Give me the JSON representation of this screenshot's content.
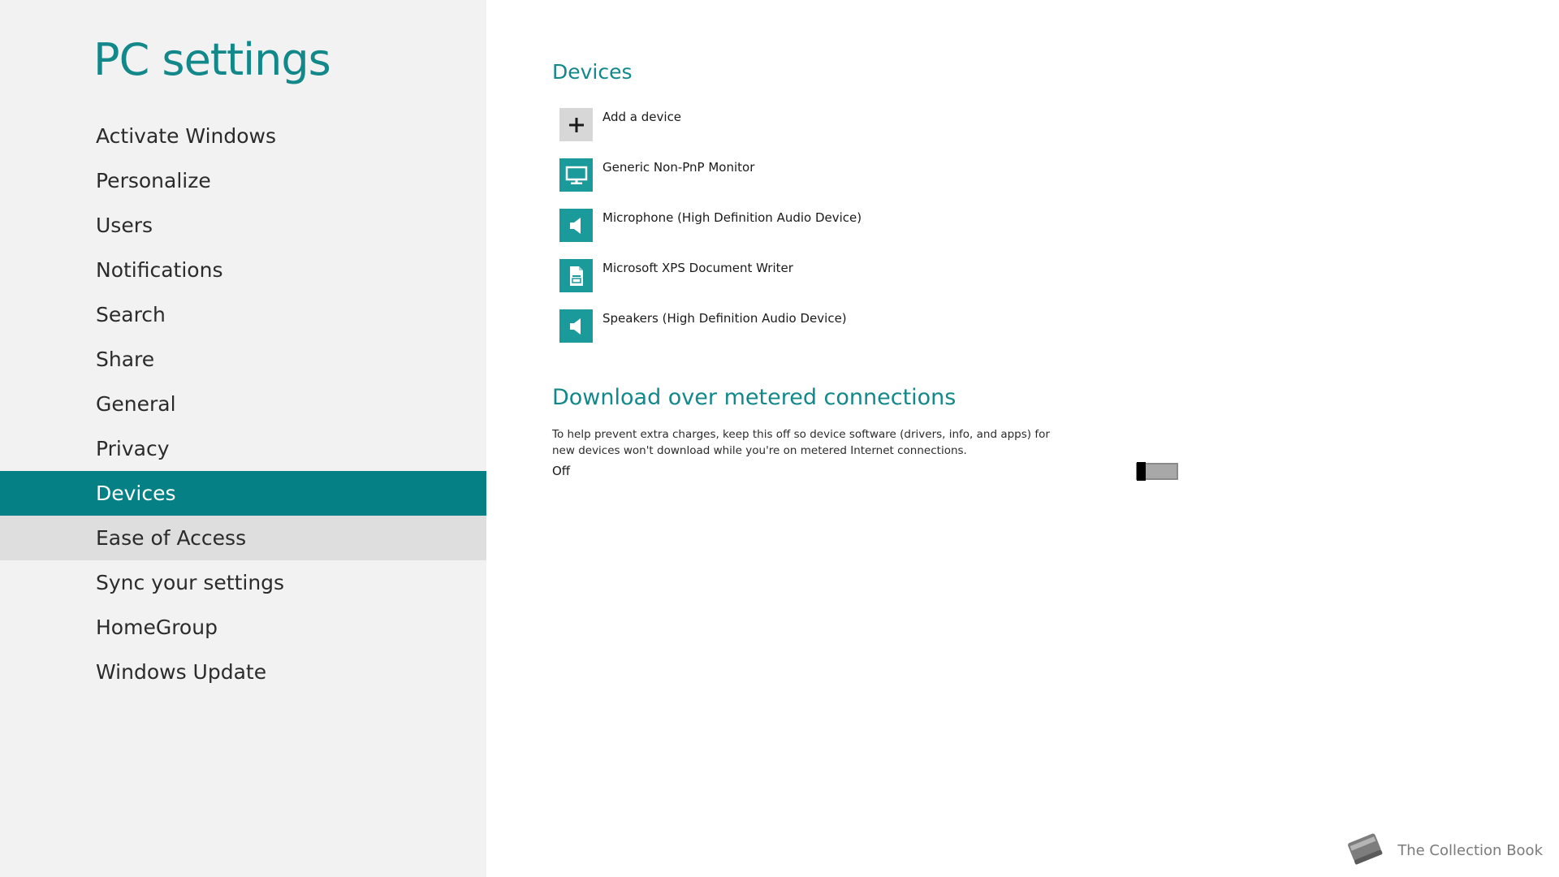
{
  "app": {
    "title": "PC settings"
  },
  "sidebar": {
    "items": [
      {
        "label": "Activate Windows"
      },
      {
        "label": "Personalize"
      },
      {
        "label": "Users"
      },
      {
        "label": "Notifications"
      },
      {
        "label": "Search"
      },
      {
        "label": "Share"
      },
      {
        "label": "General"
      },
      {
        "label": "Privacy"
      },
      {
        "label": "Devices",
        "selected": true
      },
      {
        "label": "Ease of Access",
        "hovered": true
      },
      {
        "label": "Sync your settings"
      },
      {
        "label": "HomeGroup"
      },
      {
        "label": "Windows Update"
      }
    ]
  },
  "devices": {
    "heading": "Devices",
    "items": [
      {
        "label": "Add a device",
        "icon": "plus-icon"
      },
      {
        "label": "Generic Non-PnP Monitor",
        "icon": "monitor-icon"
      },
      {
        "label": "Microphone (High Definition Audio Device)",
        "icon": "speaker-icon"
      },
      {
        "label": "Microsoft XPS Document Writer",
        "icon": "printer-icon"
      },
      {
        "label": "Speakers (High Definition Audio Device)",
        "icon": "speaker-icon"
      }
    ]
  },
  "metered": {
    "heading": "Download over metered connections",
    "description": "To help prevent extra charges, keep this off so device software (drivers, info, and apps) for new devices won't download while you're on metered Internet connections.",
    "toggle_state": "Off",
    "toggle_on": false
  },
  "watermark": {
    "text": "The Collection Book",
    "icon": "book-icon"
  },
  "colors": {
    "accent": "#12888a",
    "selected_bg": "#058186",
    "tile_bg": "#1b9a9c",
    "sidebar_bg": "#f2f2f2",
    "hover_bg": "#dedede"
  }
}
